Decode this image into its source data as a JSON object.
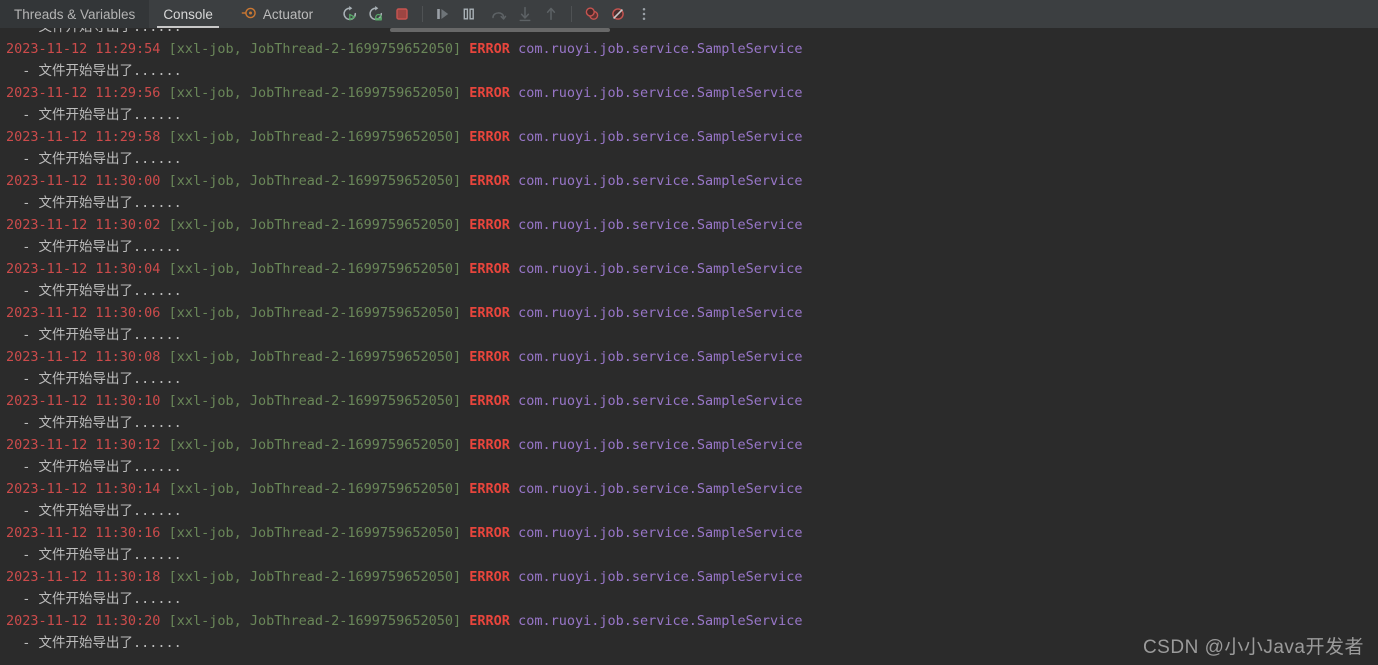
{
  "toolbar": {
    "tabs": [
      {
        "label": "Threads & Variables",
        "state": "inactive-dark",
        "icon": null
      },
      {
        "label": "Console",
        "state": "active",
        "icon": null
      },
      {
        "label": "Actuator",
        "state": "inactive",
        "icon": "actuator-icon"
      }
    ],
    "buttons": [
      {
        "name": "rerun-button",
        "title": "Rerun"
      },
      {
        "name": "rerun-debug-button",
        "title": "Debug"
      },
      {
        "name": "stop-button",
        "title": "Stop"
      },
      {
        "name": "resume-program-button",
        "title": "Resume Program"
      },
      {
        "name": "pause-program-button",
        "title": "Pause Program"
      },
      {
        "name": "step-over-button",
        "title": "Step Over"
      },
      {
        "name": "step-into-button",
        "title": "Step Into"
      },
      {
        "name": "step-out-button",
        "title": "Step Out"
      },
      {
        "name": "view-breakpoints-button",
        "title": "View Breakpoints"
      },
      {
        "name": "mute-breakpoints-button",
        "title": "Mute Breakpoints"
      },
      {
        "name": "more-options-button",
        "title": "More"
      }
    ]
  },
  "console": {
    "scrollbar": {
      "visible": true
    },
    "plain_line_text": "  - 文件开始导出了......",
    "log_prefix_bracket": "[xxl-job, JobThread-2-1699759652050]",
    "log_level": "ERROR",
    "logger_name": "com.ruoyi.job.service.SampleService",
    "log_date": "2023-11-12",
    "lines": [
      {
        "type": "plain",
        "clipped": true,
        "text": "  - 文件开始导出了......"
      },
      {
        "type": "log",
        "time": "11:29:54"
      },
      {
        "type": "plain",
        "text": "  - 文件开始导出了......"
      },
      {
        "type": "log",
        "time": "11:29:56"
      },
      {
        "type": "plain",
        "text": "  - 文件开始导出了......"
      },
      {
        "type": "log",
        "time": "11:29:58"
      },
      {
        "type": "plain",
        "text": "  - 文件开始导出了......"
      },
      {
        "type": "log",
        "time": "11:30:00"
      },
      {
        "type": "plain",
        "text": "  - 文件开始导出了......"
      },
      {
        "type": "log",
        "time": "11:30:02"
      },
      {
        "type": "plain",
        "text": "  - 文件开始导出了......"
      },
      {
        "type": "log",
        "time": "11:30:04"
      },
      {
        "type": "plain",
        "text": "  - 文件开始导出了......"
      },
      {
        "type": "log",
        "time": "11:30:06"
      },
      {
        "type": "plain",
        "text": "  - 文件开始导出了......"
      },
      {
        "type": "log",
        "time": "11:30:08"
      },
      {
        "type": "plain",
        "text": "  - 文件开始导出了......"
      },
      {
        "type": "log",
        "time": "11:30:10"
      },
      {
        "type": "plain",
        "text": "  - 文件开始导出了......"
      },
      {
        "type": "log",
        "time": "11:30:12"
      },
      {
        "type": "plain",
        "text": "  - 文件开始导出了......"
      },
      {
        "type": "log",
        "time": "11:30:14"
      },
      {
        "type": "plain",
        "text": "  - 文件开始导出了......"
      },
      {
        "type": "log",
        "time": "11:30:16"
      },
      {
        "type": "plain",
        "text": "  - 文件开始导出了......"
      },
      {
        "type": "log",
        "time": "11:30:18"
      },
      {
        "type": "plain",
        "text": "  - 文件开始导出了......"
      },
      {
        "type": "log",
        "time": "11:30:20"
      },
      {
        "type": "plain",
        "text": "  - 文件开始导出了......"
      }
    ]
  },
  "watermark": {
    "text": "CSDN @小小Java开发者"
  },
  "colors": {
    "background": "#2b2b2b",
    "toolbar_background": "#3c3f41",
    "timestamp": "#cc4b4b",
    "thread": "#6a8759",
    "error": "#e8453c",
    "logger": "#9876c8",
    "plain_text": "#bcbcbc",
    "accent_orange": "#cc7832",
    "stop_red": "#c75450",
    "run_green": "#59a869"
  }
}
